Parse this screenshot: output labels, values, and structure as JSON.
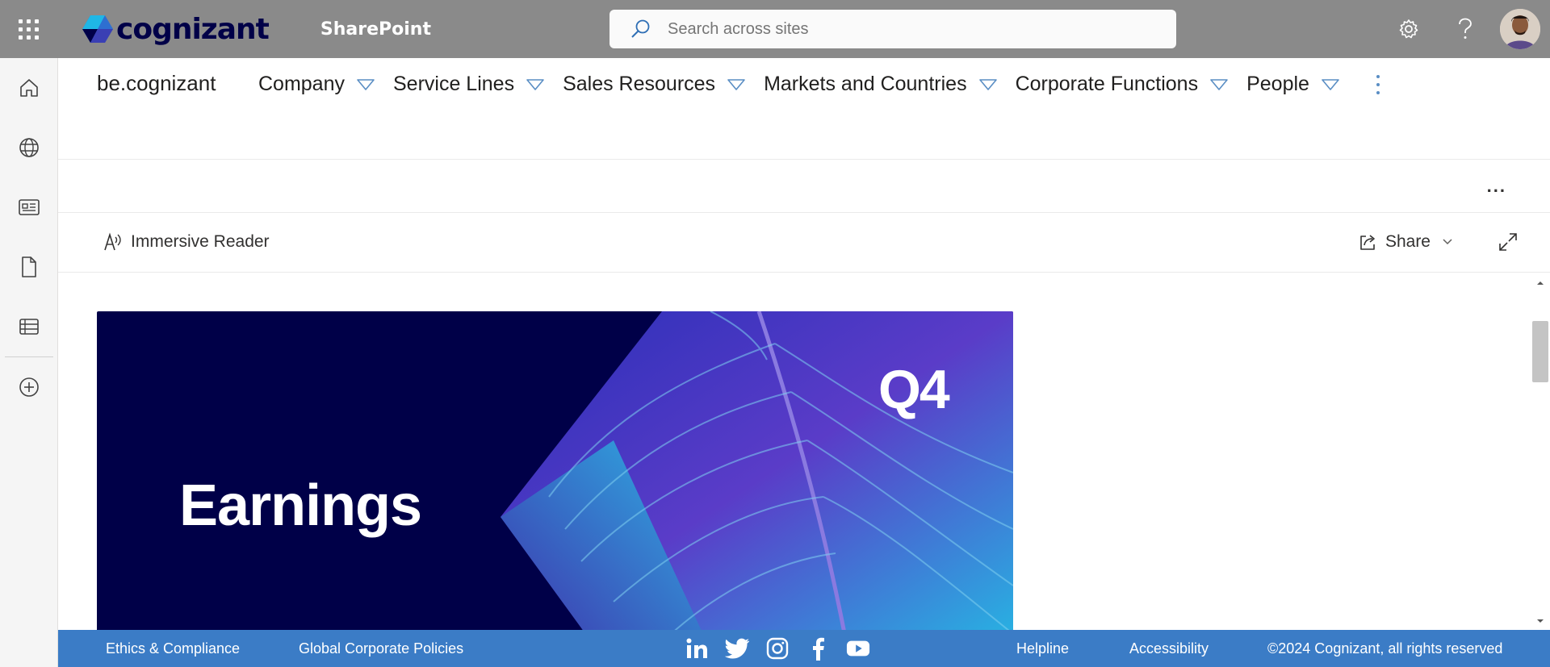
{
  "suitebar": {
    "brand": "cognizant",
    "app_name": "SharePoint",
    "search_placeholder": "Search across sites",
    "icons": [
      "waffle-icon",
      "settings-icon",
      "help-icon",
      "avatar"
    ]
  },
  "rail": {
    "items": [
      "home-icon",
      "globe-icon",
      "news-icon",
      "file-icon",
      "list-icon",
      "add-icon"
    ]
  },
  "site": {
    "title": "be.cognizant",
    "nav": [
      {
        "label": "Company"
      },
      {
        "label": "Service Lines"
      },
      {
        "label": "Sales Resources"
      },
      {
        "label": "Markets and Countries"
      },
      {
        "label": "Corporate Functions"
      },
      {
        "label": "People"
      }
    ]
  },
  "page_actions": {
    "more": "..."
  },
  "commandbar": {
    "immersive_reader": "Immersive Reader",
    "share": "Share"
  },
  "hero": {
    "title": "Earnings",
    "badge": "Q4"
  },
  "footer": {
    "ethics": "Ethics & Compliance",
    "policies": "Global Corporate Policies",
    "socials": [
      "linkedin-icon",
      "twitter-icon",
      "instagram-icon",
      "facebook-icon",
      "youtube-icon"
    ],
    "helpline": "Helpline",
    "accessibility": "Accessibility",
    "copyright": "©2024 Cognizant, all rights reserved"
  },
  "colors": {
    "suitebar": "#8a8a8a",
    "brand_navy": "#000048",
    "footer": "#3b7cc6",
    "nav_caret": "#5a8ec4"
  }
}
